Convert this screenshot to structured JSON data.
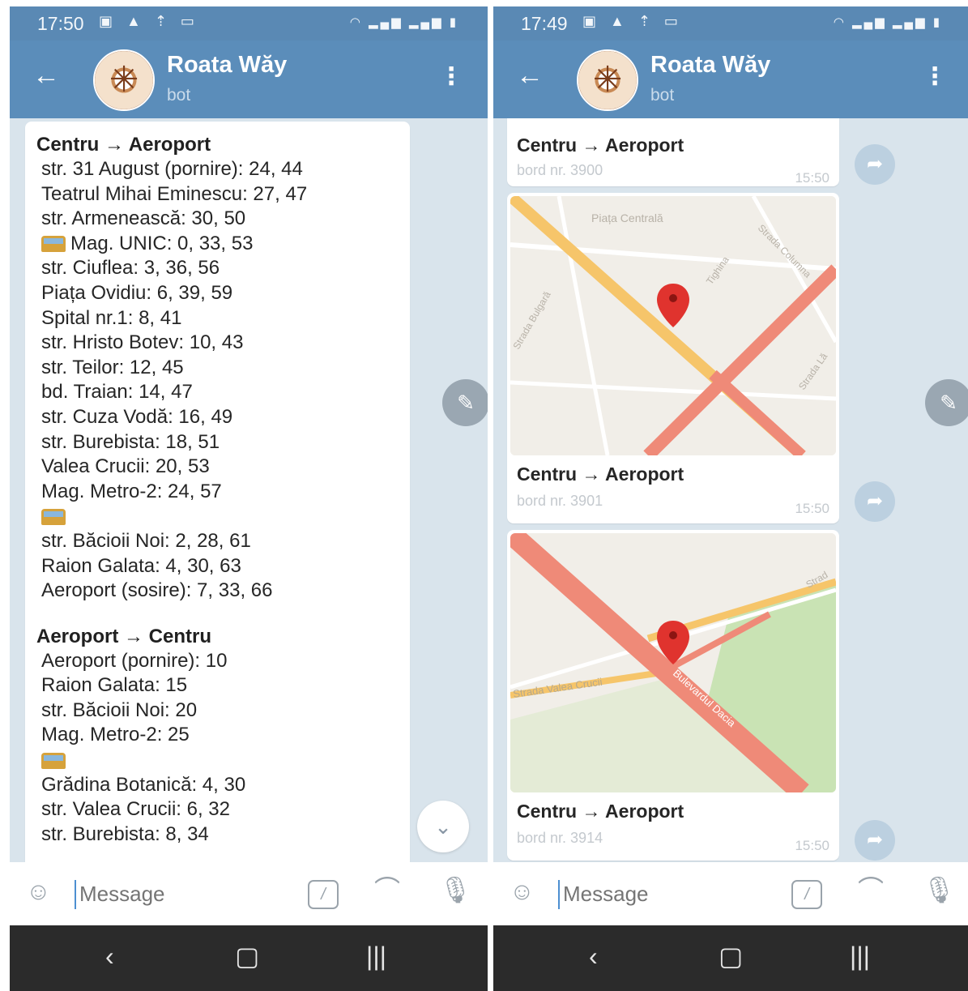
{
  "status_left": {
    "time": "17:50"
  },
  "status_right": {
    "time": "17:49"
  },
  "header": {
    "title": "Roata Wăy",
    "subtitle": "bot"
  },
  "input": {
    "placeholder": "Message"
  },
  "left_message": {
    "section1_title": "Centru → Aeroport",
    "section1_lines": [
      "str. 31 August (pornire): 24, 44",
      "Teatrul Mihai Eminescu: 27, 47",
      "str. Armenească: 30, 50",
      "Mag. UNIC: 0, 33, 53",
      "str. Ciuflea: 3, 36, 56",
      "Piața Ovidiu: 6, 39, 59",
      "Spital nr.1: 8, 41",
      "str. Hristo Botev: 10, 43",
      "str. Teilor: 12, 45",
      "bd. Traian: 14, 47",
      "str. Cuza Vodă: 16, 49",
      "str. Burebista: 18, 51",
      "Valea Crucii: 20, 53",
      "Mag. Metro-2: 24, 57",
      "",
      "str. Băcioii Noi: 2, 28, 61",
      "Raion Galata: 4, 30, 63",
      "Aeroport (sosire): 7, 33, 66"
    ],
    "section2_title": "Aeroport → Centru",
    "section2_lines": [
      "Aeroport (pornire): 10",
      "Raion Galata: 15",
      "str. Băcioii Noi: 20",
      "Mag. Metro-2: 25",
      "",
      "Grădina Botanică: 4, 30",
      "str. Valea Crucii: 6, 32",
      "str. Burebista: 8, 34"
    ]
  },
  "right_messages": [
    {
      "title": "Centru → Aeroport",
      "sub": "bord nr. 3900",
      "time": "15:50"
    },
    {
      "title": "Centru → Aeroport",
      "sub": "bord nr. 3901",
      "time": "15:50"
    },
    {
      "title": "Centru → Aeroport",
      "sub": "bord nr. 3914",
      "time": "15:50"
    }
  ],
  "map1_labels": {
    "a": "Piața Centrală",
    "b": "Strada Columna",
    "c": "Strada Bulgară",
    "d": "Tighina",
    "e": "Strada Lă"
  },
  "map2_labels": {
    "a": "Strada Valea Crucii",
    "b": "Bulevardul Dacia",
    "c": "Strad"
  },
  "colors": {
    "header": "#5b8dba",
    "statusbar": "#5a89b4",
    "chat_bg": "#d9e4ec",
    "navbar": "#2b2b2b",
    "pin": "#e0332e"
  }
}
